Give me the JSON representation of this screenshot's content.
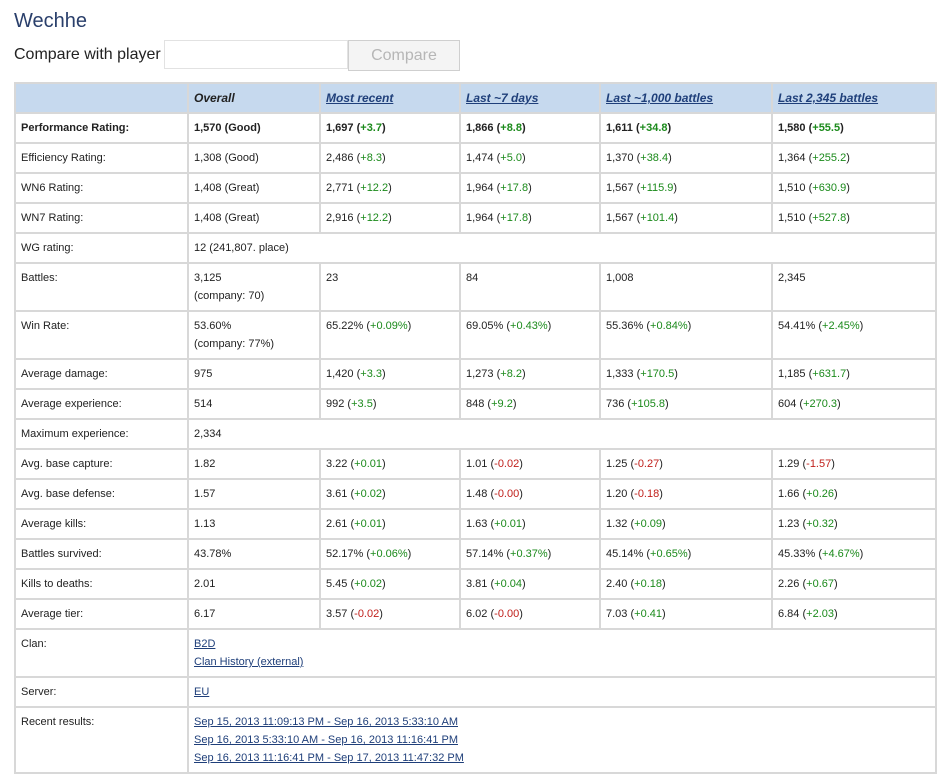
{
  "player": {
    "name": "Wechhe"
  },
  "compare": {
    "label": "Compare with player",
    "input_value": "",
    "button": "Compare"
  },
  "table": {
    "headers": [
      "",
      "Overall",
      "Most recent",
      "Last ~7 days",
      "Last ~1,000 battles",
      "Last 2,345 battles"
    ],
    "rows": {
      "perf": {
        "label": "Performance Rating:",
        "overall": "1,570 (Good)",
        "cells": [
          {
            "v": "1,697",
            "d": "+3.7",
            "sign": "pos"
          },
          {
            "v": "1,866",
            "d": "+8.8",
            "sign": "pos"
          },
          {
            "v": "1,611",
            "d": "+34.8",
            "sign": "pos"
          },
          {
            "v": "1,580",
            "d": "+55.5",
            "sign": "pos"
          }
        ]
      },
      "eff": {
        "label": "Efficiency Rating:",
        "overall": "1,308 (Good)",
        "cells": [
          {
            "v": "2,486",
            "d": "+8.3",
            "sign": "pos"
          },
          {
            "v": "1,474",
            "d": "+5.0",
            "sign": "pos"
          },
          {
            "v": "1,370",
            "d": "+38.4",
            "sign": "pos"
          },
          {
            "v": "1,364",
            "d": "+255.2",
            "sign": "pos"
          }
        ]
      },
      "wn6": {
        "label": "WN6 Rating:",
        "overall": "1,408 (Great)",
        "cells": [
          {
            "v": "2,771",
            "d": "+12.2",
            "sign": "pos"
          },
          {
            "v": "1,964",
            "d": "+17.8",
            "sign": "pos"
          },
          {
            "v": "1,567",
            "d": "+115.9",
            "sign": "pos"
          },
          {
            "v": "1,510",
            "d": "+630.9",
            "sign": "pos"
          }
        ]
      },
      "wn7": {
        "label": "WN7 Rating:",
        "overall": "1,408 (Great)",
        "cells": [
          {
            "v": "2,916",
            "d": "+12.2",
            "sign": "pos"
          },
          {
            "v": "1,964",
            "d": "+17.8",
            "sign": "pos"
          },
          {
            "v": "1,567",
            "d": "+101.4",
            "sign": "pos"
          },
          {
            "v": "1,510",
            "d": "+527.8",
            "sign": "pos"
          }
        ]
      },
      "wg": {
        "label": "WG rating:",
        "value": "12 (241,807. place)"
      },
      "battles": {
        "label": "Battles:",
        "overall": "3,125",
        "overall_sub": "(company: 70)",
        "values": [
          "23",
          "84",
          "1,008",
          "2,345"
        ]
      },
      "winrate": {
        "label": "Win Rate:",
        "overall": "53.60%",
        "overall_sub": "(company: 77%)",
        "cells": [
          {
            "v": "65.22%",
            "d": "+0.09%",
            "sign": "pos"
          },
          {
            "v": "69.05%",
            "d": "+0.43%",
            "sign": "pos"
          },
          {
            "v": "55.36%",
            "d": "+0.84%",
            "sign": "pos"
          },
          {
            "v": "54.41%",
            "d": "+2.45%",
            "sign": "pos"
          }
        ]
      },
      "avgdmg": {
        "label": "Average damage:",
        "overall": "975",
        "cells": [
          {
            "v": "1,420",
            "d": "+3.3",
            "sign": "pos"
          },
          {
            "v": "1,273",
            "d": "+8.2",
            "sign": "pos"
          },
          {
            "v": "1,333",
            "d": "+170.5",
            "sign": "pos"
          },
          {
            "v": "1,185",
            "d": "+631.7",
            "sign": "pos"
          }
        ]
      },
      "avgxp": {
        "label": "Average experience:",
        "overall": "514",
        "cells": [
          {
            "v": "992",
            "d": "+3.5",
            "sign": "pos"
          },
          {
            "v": "848",
            "d": "+9.2",
            "sign": "pos"
          },
          {
            "v": "736",
            "d": "+105.8",
            "sign": "pos"
          },
          {
            "v": "604",
            "d": "+270.3",
            "sign": "pos"
          }
        ]
      },
      "maxxp": {
        "label": "Maximum experience:",
        "value": "2,334"
      },
      "cap": {
        "label": "Avg. base capture:",
        "overall": "1.82",
        "cells": [
          {
            "v": "3.22",
            "d": "+0.01",
            "sign": "pos"
          },
          {
            "v": "1.01",
            "d": "-0.02",
            "sign": "neg"
          },
          {
            "v": "1.25",
            "d": "-0.27",
            "sign": "neg"
          },
          {
            "v": "1.29",
            "d": "-1.57",
            "sign": "neg"
          }
        ]
      },
      "def": {
        "label": "Avg. base defense:",
        "overall": "1.57",
        "cells": [
          {
            "v": "3.61",
            "d": "+0.02",
            "sign": "pos"
          },
          {
            "v": "1.48",
            "d": "-0.00",
            "sign": "neg"
          },
          {
            "v": "1.20",
            "d": "-0.18",
            "sign": "neg"
          },
          {
            "v": "1.66",
            "d": "+0.26",
            "sign": "pos"
          }
        ]
      },
      "kills": {
        "label": "Average kills:",
        "overall": "1.13",
        "cells": [
          {
            "v": "2.61",
            "d": "+0.01",
            "sign": "pos"
          },
          {
            "v": "1.63",
            "d": "+0.01",
            "sign": "pos"
          },
          {
            "v": "1.32",
            "d": "+0.09",
            "sign": "pos"
          },
          {
            "v": "1.23",
            "d": "+0.32",
            "sign": "pos"
          }
        ]
      },
      "survived": {
        "label": "Battles survived:",
        "overall": "43.78%",
        "cells": [
          {
            "v": "52.17%",
            "d": "+0.06%",
            "sign": "pos"
          },
          {
            "v": "57.14%",
            "d": "+0.37%",
            "sign": "pos"
          },
          {
            "v": "45.14%",
            "d": "+0.65%",
            "sign": "pos"
          },
          {
            "v": "45.33%",
            "d": "+4.67%",
            "sign": "pos"
          }
        ]
      },
      "kd": {
        "label": "Kills to deaths:",
        "overall": "2.01",
        "cells": [
          {
            "v": "5.45",
            "d": "+0.02",
            "sign": "pos"
          },
          {
            "v": "3.81",
            "d": "+0.04",
            "sign": "pos"
          },
          {
            "v": "2.40",
            "d": "+0.18",
            "sign": "pos"
          },
          {
            "v": "2.26",
            "d": "+0.67",
            "sign": "pos"
          }
        ]
      },
      "tier": {
        "label": "Average tier:",
        "overall": "6.17",
        "cells": [
          {
            "v": "3.57",
            "d": "-0.02",
            "sign": "neg"
          },
          {
            "v": "6.02",
            "d": "-0.00",
            "sign": "neg"
          },
          {
            "v": "7.03",
            "d": "+0.41",
            "sign": "pos"
          },
          {
            "v": "6.84",
            "d": "+2.03",
            "sign": "pos"
          }
        ]
      },
      "clan": {
        "label": "Clan:",
        "name": "B2D",
        "history": "Clan History (external)"
      },
      "server": {
        "label": "Server:",
        "value": "EU"
      },
      "recent": {
        "label": "Recent results:",
        "links": [
          "Sep 15, 2013 11:09:13 PM - Sep 16, 2013 5:33:10 AM",
          "Sep 16, 2013 5:33:10 AM - Sep 16, 2013 11:16:41 PM",
          "Sep 16, 2013 11:16:41 PM - Sep 17, 2013 11:47:32 PM"
        ]
      }
    }
  },
  "colors": {
    "header_bg": "#c6d9ee",
    "positive": "#1b8a1b",
    "negative": "#c0201b",
    "link": "#1f3f7a"
  }
}
